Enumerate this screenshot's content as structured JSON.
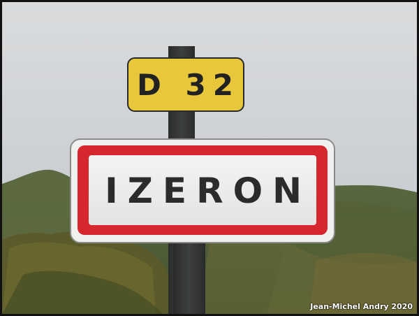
{
  "route_sign": {
    "text": "D 32",
    "color": "#e8c83a"
  },
  "place_sign": {
    "text": "IZERON",
    "border_color": "#d6262e"
  },
  "credit": {
    "text": "Jean-Michel Andry 2020"
  }
}
